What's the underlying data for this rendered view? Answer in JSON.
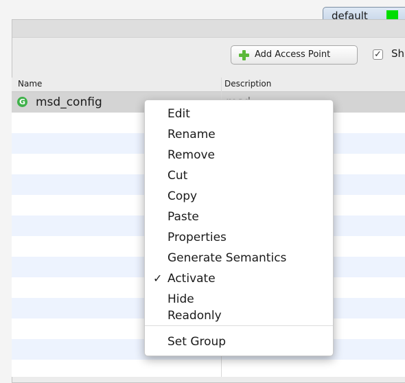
{
  "profile": {
    "label": "default",
    "swatch_color": "#00dd00"
  },
  "toolbar": {
    "add_label": "Add Access Point",
    "show_checkbox_checked": true,
    "show_label": "Sh"
  },
  "table": {
    "columns": [
      "Name",
      "Description"
    ],
    "rows": [
      {
        "name": "msd_config",
        "description": "msd"
      }
    ]
  },
  "context_menu": {
    "items": [
      "Edit",
      "Rename",
      "Remove",
      "Cut",
      "Copy",
      "Paste",
      "Properties",
      "Generate Semantics",
      "Activate",
      "Hide",
      "Readonly"
    ],
    "checked_item": "Activate",
    "after_separator": [
      "Set Group"
    ]
  },
  "icons": {
    "add": "plus-icon",
    "row": "access-point-icon",
    "check": "checkmark-icon"
  }
}
